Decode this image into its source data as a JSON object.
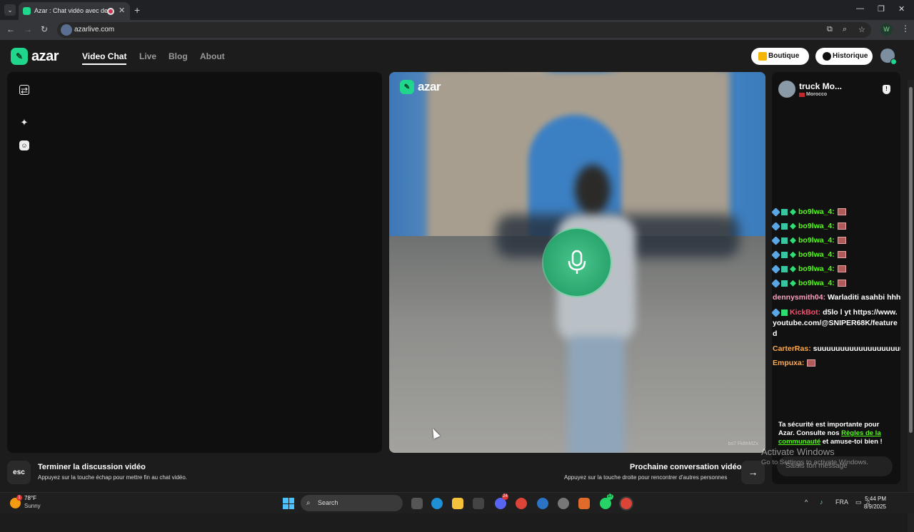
{
  "browser": {
    "tab_title": "Azar : Chat vidéo avec de n",
    "tab_close": "✕",
    "new_tab": "+",
    "url": "azarlive.com",
    "profile_initial": "W",
    "window_min": "—",
    "window_max": "❐",
    "window_close": "✕"
  },
  "header": {
    "logo_text": "azar",
    "nav": [
      "Video Chat",
      "Live",
      "Blog",
      "About"
    ],
    "active_nav": "Video Chat",
    "boutique": "Boutique",
    "historique": "Historique"
  },
  "video": {
    "logo_text": "azar",
    "session_id": "bs7 Fk8hMZx"
  },
  "peer": {
    "name": "truck Mo...",
    "country": "Morocco"
  },
  "chat": {
    "messages": [
      {
        "user": "bo9lwa_4:",
        "text": "",
        "badges": true,
        "emote": true,
        "color": "green"
      },
      {
        "user": "bo9lwa_4:",
        "text": "",
        "badges": true,
        "emote": true,
        "color": "green"
      },
      {
        "user": "bo9lwa_4:",
        "text": "",
        "badges": true,
        "emote": true,
        "color": "green"
      },
      {
        "user": "bo9lwa_4:",
        "text": "",
        "badges": true,
        "emote": true,
        "color": "green"
      },
      {
        "user": "bo9lwa_4:",
        "text": "",
        "badges": true,
        "emote": true,
        "color": "green"
      },
      {
        "user": "bo9lwa_4:",
        "text": "",
        "badges": true,
        "emote": true,
        "color": "green"
      }
    ],
    "dennysmith_user": "dennysmith04:",
    "dennysmith_text": "Warladiti asahbi hhh",
    "kickbot_user": "KickBot:",
    "kickbot_text": "d5lo l yt https://www.youtube.com/@SNIPER68K/featured",
    "carter_user": "CarterRas:",
    "carter_text": "suuuuuuuuuuuuuuuuuuu",
    "empuxa_user": "Empuxa:",
    "safety_before": "Ta sécurité est importante pour Azar. Consulte nos ",
    "safety_link": "Règles de la communauté",
    "safety_after": " et amuse-toi bien !",
    "input_placeholder": "Saisis ton message"
  },
  "footer": {
    "esc_key": "esc",
    "end_title": "Terminer la discussion vidéo",
    "end_sub": "Appuyez sur la touche échap pour mettre fin au chat vidéo.",
    "next_title": "Prochaine conversation vidéo",
    "next_sub": "Appuyez sur la touche droite pour rencontrer d'autres personnes",
    "next_key": "→"
  },
  "windows_watermark": {
    "title": "Activate Windows",
    "sub": "Go to Settings to activate Windows."
  },
  "taskbar": {
    "temp": "78°F",
    "condition": "Sunny",
    "weather_badge": "1",
    "search": "Search",
    "lang": "FRA",
    "time": "5:44 PM",
    "date": "8/9/2025",
    "badge_discord": "24",
    "badge_whatsapp": "17"
  },
  "colors": {
    "accent": "#1fd68c",
    "kick_green": "#53fc18"
  }
}
